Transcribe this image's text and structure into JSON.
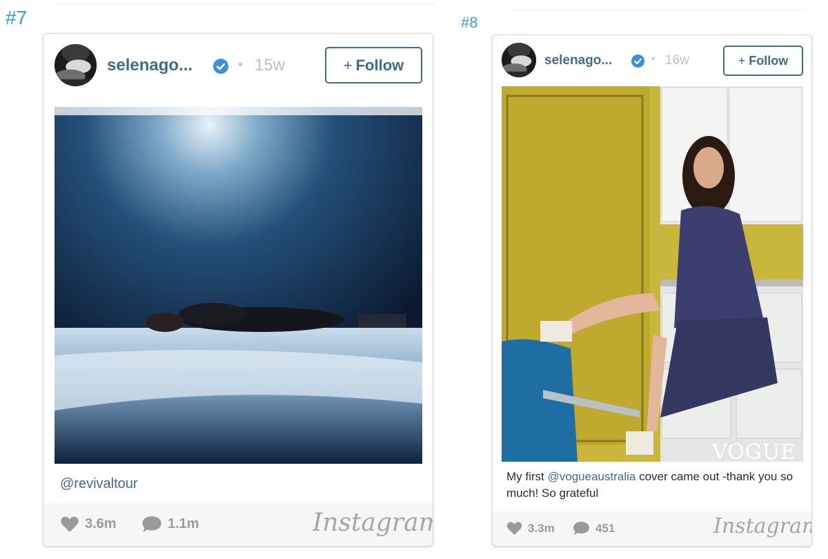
{
  "posts": [
    {
      "rank": "#7",
      "username": "selenago...",
      "time": "15w",
      "follow_label": "Follow",
      "follow_plus": "+",
      "caption_mention": "@revivaltour",
      "likes": "3.6m",
      "comments": "1.1m",
      "brand": "Instagram"
    },
    {
      "rank": "#8",
      "username": "selenago...",
      "time": "16w",
      "follow_label": "Follow",
      "follow_plus": "+",
      "caption_prefix": "My first ",
      "caption_mention": "@vogueaustralia",
      "caption_suffix": " cover came out -thank you so much! So grateful",
      "photo_overlay_text": "VOGUE",
      "likes": "3.3m",
      "comments": "451",
      "brand": "Instagram"
    }
  ],
  "colors": {
    "rank": "#3b9ad9",
    "username": "#3f6b8c",
    "verified": "#3d90d6",
    "muted": "#9a9a9a",
    "footer_bg": "#f6f6f7"
  },
  "icons": [
    "verified-badge-icon",
    "plus-icon",
    "heart-icon",
    "comment-icon"
  ]
}
